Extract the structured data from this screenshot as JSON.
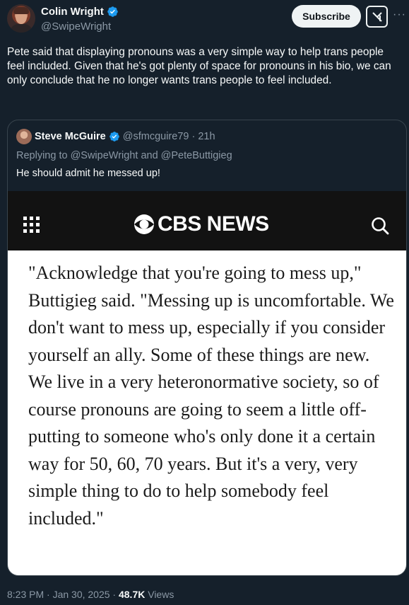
{
  "author": {
    "display_name": "Colin Wright",
    "handle": "@SwipeWright"
  },
  "header": {
    "subscribe_label": "Subscribe",
    "more_label": "···"
  },
  "tweet": {
    "text": "Pete said that displaying pronouns was a very simple way to help trans people feel included. Given that he's got plenty of space for pronouns in his bio, we can only conclude that he no longer wants trans people to feel included."
  },
  "quoted": {
    "display_name": "Steve McGuire",
    "handle_time": "@sfmcguire79 · 21h",
    "replying_to": "Replying to @SwipeWright and @PeteButtigieg",
    "text": "He should admit he messed up!",
    "media": {
      "brand": "CBS NEWS",
      "quote": "\"Acknowledge that you're going to mess up,\" Buttigieg said. \"Messing up is uncomfortable. We don't want to mess up, especially if you consider yourself an ally. Some of these things are new. We live in a very heteronormative society, so of course pronouns are going to seem a little off-putting to someone who's only done it a certain way for 50, 60, 70 years. But it's a very, very simple thing to do to help somebody feel included.\""
    }
  },
  "footer": {
    "timestamp": "8:23 PM · Jan 30, 2025 · ",
    "views_count": "48.7K",
    "views_label": " Views"
  },
  "colors": {
    "background": "#15202b",
    "verified_blue": "#1d9bf0",
    "secondary_text": "#8b98a5"
  }
}
